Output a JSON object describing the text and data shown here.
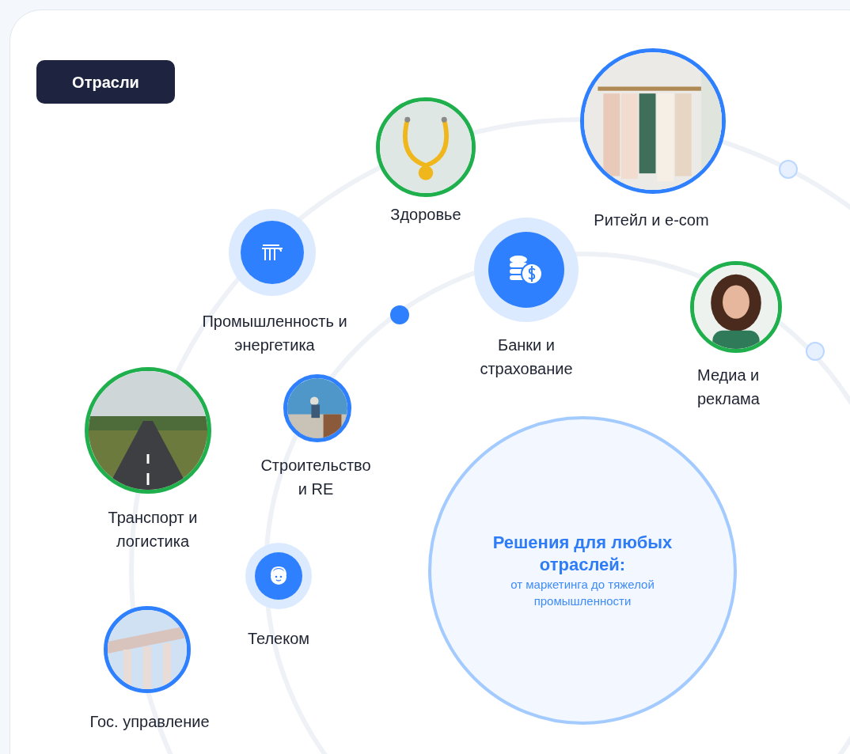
{
  "badge": "Отрасли",
  "industries": [
    {
      "kind": "picture",
      "label": "Здоровье",
      "color": "#1fb04d"
    },
    {
      "kind": "picture",
      "label": "Ритейл и e-com",
      "color": "#2f80ff"
    },
    {
      "kind": "icon",
      "label": "Промышленность и\nэнергетика"
    },
    {
      "kind": "icon",
      "label": "Банки и\nстрахование"
    },
    {
      "kind": "picture",
      "label": "Медиа и\nреклама",
      "color": "#1fb04d"
    },
    {
      "kind": "picture",
      "label": "Транспорт и\nлогистика",
      "color": "#1fb04d"
    },
    {
      "kind": "picture",
      "label": "Строительство\nи RE",
      "color": "#2f80ff"
    },
    {
      "kind": "icon",
      "label": "Телеком"
    },
    {
      "kind": "picture",
      "label": "Гос. управление",
      "color": "#2f80ff"
    }
  ],
  "center": {
    "title": "Решения для любых отраслей:",
    "subtitle": "от маркетинга до тяжелой промышленности"
  }
}
